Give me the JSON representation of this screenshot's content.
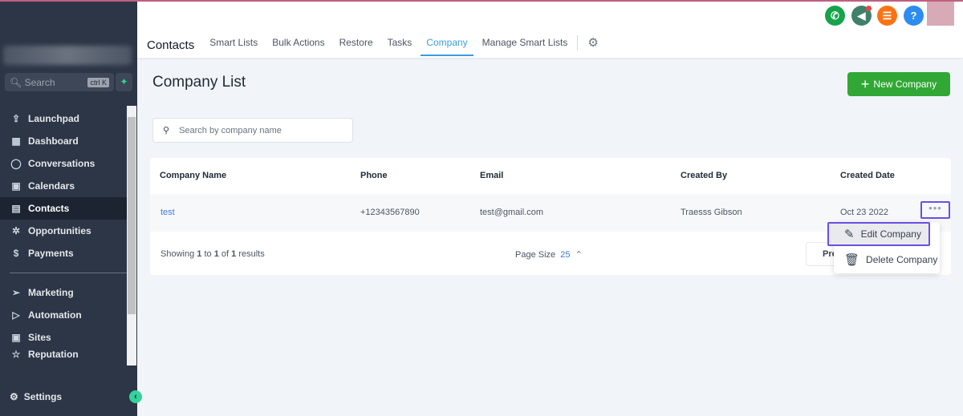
{
  "sidebar": {
    "search_placeholder": "Search",
    "shortcut": "ctrl K",
    "items": [
      {
        "label": "Launchpad",
        "icon": "⇪"
      },
      {
        "label": "Dashboard",
        "icon": "▦"
      },
      {
        "label": "Conversations",
        "icon": "◯"
      },
      {
        "label": "Calendars",
        "icon": "▣"
      },
      {
        "label": "Contacts",
        "icon": "▤"
      },
      {
        "label": "Opportunities",
        "icon": "✲"
      },
      {
        "label": "Payments",
        "icon": "$"
      }
    ],
    "items2": [
      {
        "label": "Marketing",
        "icon": "➢"
      },
      {
        "label": "Automation",
        "icon": "▷"
      },
      {
        "label": "Sites",
        "icon": "▣"
      },
      {
        "label": "Reputation",
        "icon": "☆"
      }
    ],
    "settings": "Settings"
  },
  "topbar": {
    "icons": [
      {
        "name": "phone",
        "glyph": "✆",
        "color": "#16a34a"
      },
      {
        "name": "megaphone",
        "glyph": "◀",
        "color": "#3f8068"
      },
      {
        "name": "list",
        "glyph": "☰",
        "color": "#f97316"
      },
      {
        "name": "help",
        "glyph": "?",
        "color": "#2d8cf0"
      }
    ]
  },
  "tabs": {
    "title": "Contacts",
    "items": [
      "Smart Lists",
      "Bulk Actions",
      "Restore",
      "Tasks",
      "Company",
      "Manage Smart Lists"
    ],
    "active": "Company"
  },
  "page": {
    "title": "Company List",
    "new_button": "New Company",
    "search_placeholder": "Search by company name"
  },
  "table": {
    "headers": [
      "Company Name",
      "Phone",
      "Email",
      "Created By",
      "Created Date"
    ],
    "rows": [
      {
        "name": "test",
        "phone": "+12343567890",
        "email": "test@gmail.com",
        "created_by": "Traesss Gibson",
        "created_date": "Oct 23 2022"
      }
    ]
  },
  "footer": {
    "showing": "Showing",
    "from": "1",
    "to_label": "to",
    "to": "1",
    "of_label": "of",
    "total": "1",
    "results": "results",
    "page_size_label": "Page Size",
    "page_size": "25",
    "prev": "Pre"
  },
  "menu": {
    "edit": "Edit Company",
    "delete": "Delete Company"
  }
}
